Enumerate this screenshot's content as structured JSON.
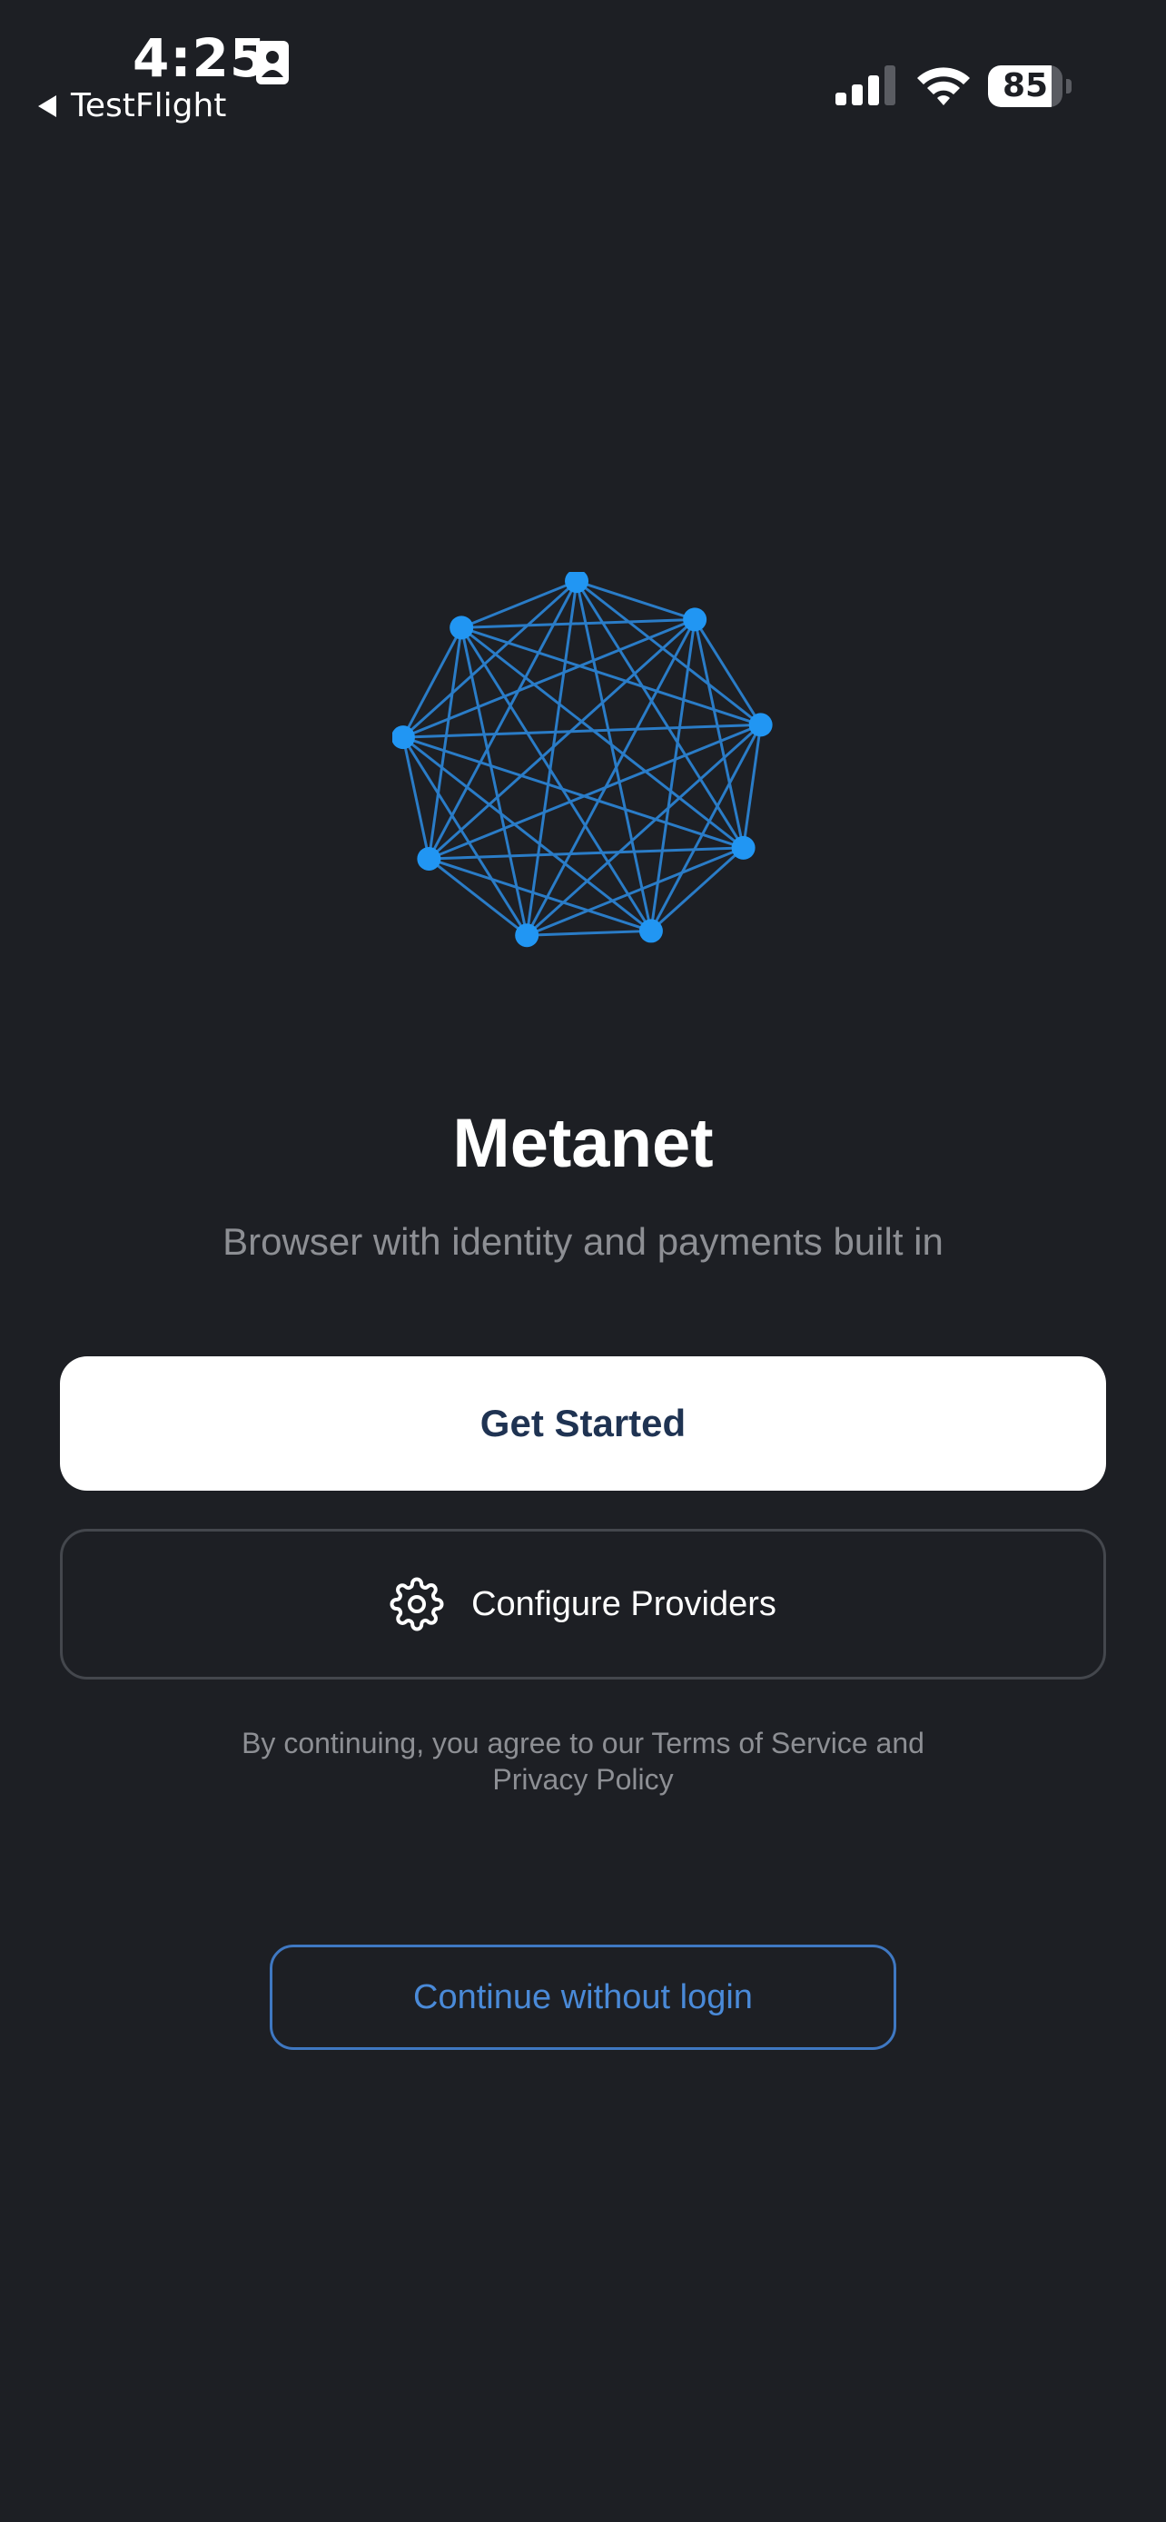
{
  "status_bar": {
    "time": "4:25",
    "back_app": "TestFlight",
    "battery_level": "85",
    "battery_fraction": 0.85,
    "icons": [
      "id-card-icon",
      "back-triangle-icon",
      "cellular-signal-icon",
      "wifi-icon",
      "battery-icon"
    ]
  },
  "logo": {
    "icon": "network-graph-logo",
    "color": "#2196f3",
    "line_color": "#2a7cc7"
  },
  "hero": {
    "title": "Metanet",
    "subtitle": "Browser with identity and payments built in"
  },
  "actions": {
    "get_started": "Get Started",
    "configure_providers": "Configure Providers",
    "configure_icon": "gear-icon",
    "continue_without_login": "Continue without login"
  },
  "legal": {
    "line1": "By continuing, you agree to our Terms of Service and",
    "line2": "Privacy Policy"
  },
  "colors": {
    "background": "#1d1f24",
    "primary_button_bg": "#ffffff",
    "primary_button_text": "#1f3352",
    "accent": "#4a8ad8",
    "muted_text": "#8d8f94"
  }
}
